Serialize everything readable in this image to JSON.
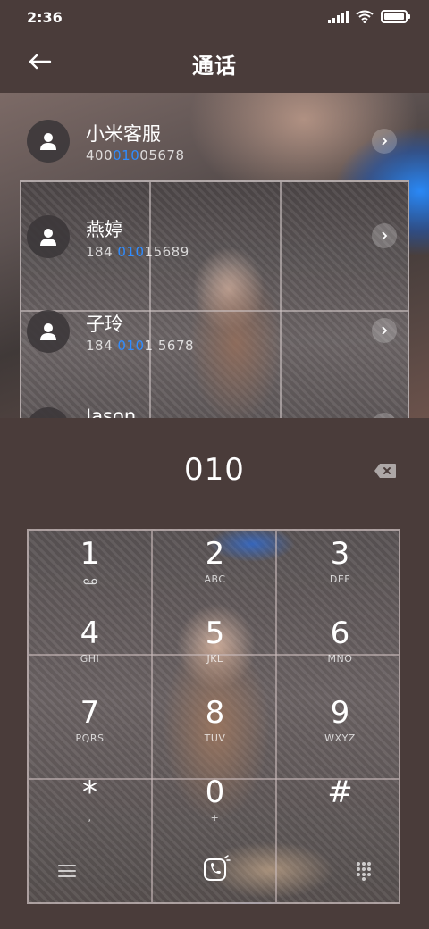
{
  "status_bar": {
    "time": "2:36"
  },
  "header": {
    "title": "通话"
  },
  "contacts": [
    {
      "name": "小米客服",
      "number_pre": "400",
      "number_match": "010",
      "number_post": "05678"
    },
    {
      "name": "燕婷",
      "number_pre": "184 ",
      "number_match": "010",
      "number_post": "15689"
    },
    {
      "name": "子玲",
      "number_pre": "184 ",
      "number_match": "010",
      "number_post": "1 5678"
    },
    {
      "name": "Jason"
    }
  ],
  "dialer": {
    "number": "010"
  },
  "keys": [
    {
      "digit": "1",
      "letters": ""
    },
    {
      "digit": "2",
      "letters": "ABC"
    },
    {
      "digit": "3",
      "letters": "DEF"
    },
    {
      "digit": "4",
      "letters": "GHI"
    },
    {
      "digit": "5",
      "letters": "JKL"
    },
    {
      "digit": "6",
      "letters": "MNO"
    },
    {
      "digit": "7",
      "letters": "PQRS"
    },
    {
      "digit": "8",
      "letters": "TUV"
    },
    {
      "digit": "9",
      "letters": "WXYZ"
    },
    {
      "digit": "*",
      "letters": ","
    },
    {
      "digit": "0",
      "letters": "+"
    },
    {
      "digit": "#",
      "letters": ""
    }
  ],
  "colors": {
    "background": "#4a3c3a",
    "match_highlight": "#2f8cff"
  },
  "icons": {
    "back": "back-arrow-icon",
    "contact": "person-icon",
    "open": "chevron-right-icon",
    "delete": "backspace-icon",
    "voicemail": "voicemail-icon",
    "menu": "menu-icon",
    "call": "phone-call-icon",
    "keypad": "dialpad-icon"
  }
}
